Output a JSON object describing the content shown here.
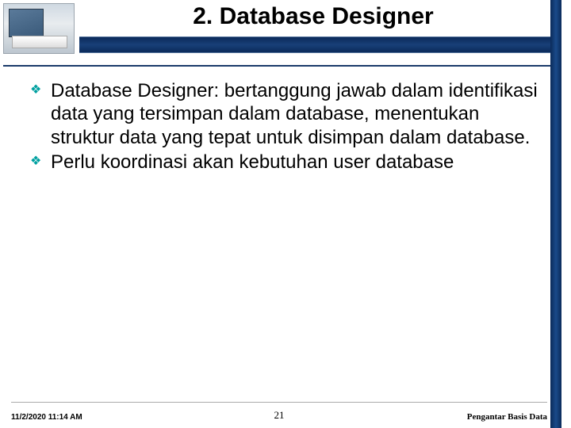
{
  "header": {
    "title": "2. Database Designer"
  },
  "bullets": [
    "Database Designer: bertanggung jawab dalam identifikasi data yang tersimpan dalam database, menentukan struktur data yang tepat untuk disimpan dalam database.",
    "Perlu koordinasi akan kebutuhan user database"
  ],
  "footer": {
    "timestamp": "11/2/2020 11:14 AM",
    "page": "21",
    "course": "Pengantar Basis Data"
  }
}
